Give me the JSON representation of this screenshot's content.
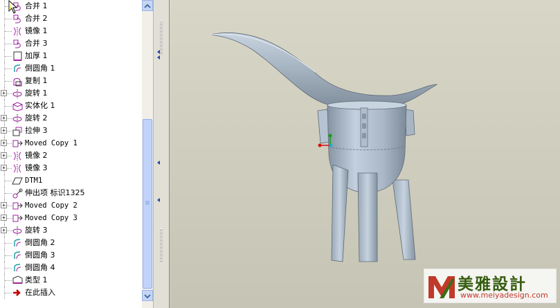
{
  "model_tree": {
    "items": [
      {
        "label": "合并 1",
        "icon": "merge-icon",
        "expandable": false
      },
      {
        "label": "合并 2",
        "icon": "merge-icon",
        "expandable": false
      },
      {
        "label": "镜像 1",
        "icon": "mirror-icon",
        "expandable": false
      },
      {
        "label": "合并 3",
        "icon": "merge-icon",
        "expandable": false
      },
      {
        "label": "加厚 1",
        "icon": "thicken-icon",
        "expandable": false
      },
      {
        "label": "倒圆角 1",
        "icon": "round-icon",
        "expandable": false
      },
      {
        "label": "复制 1",
        "icon": "copy-icon",
        "expandable": false
      },
      {
        "label": "旋转 1",
        "icon": "revolve-icon",
        "expandable": true
      },
      {
        "label": "实体化 1",
        "icon": "solidify-icon",
        "expandable": false
      },
      {
        "label": "旋转 2",
        "icon": "revolve-icon",
        "expandable": true
      },
      {
        "label": "拉伸 3",
        "icon": "extrude-icon",
        "expandable": true
      },
      {
        "label": "Moved Copy 1",
        "icon": "moved-copy-icon",
        "expandable": true
      },
      {
        "label": "镜像 2",
        "icon": "mirror-icon",
        "expandable": true
      },
      {
        "label": "镜像 3",
        "icon": "mirror-icon",
        "expandable": true
      },
      {
        "label": "DTM1",
        "icon": "datum-plane-icon",
        "expandable": false
      },
      {
        "label": "伸出项 标识1325",
        "icon": "protrusion-icon",
        "expandable": false
      },
      {
        "label": "Moved Copy 2",
        "icon": "moved-copy-icon",
        "expandable": true
      },
      {
        "label": "Moved Copy 3",
        "icon": "moved-copy-icon",
        "expandable": true
      },
      {
        "label": "旋转 3",
        "icon": "revolve-icon",
        "expandable": true
      },
      {
        "label": "倒圆角 2",
        "icon": "round-icon",
        "expandable": false
      },
      {
        "label": "倒圆角 3",
        "icon": "round-icon",
        "expandable": false
      },
      {
        "label": "倒圆角 4",
        "icon": "round-icon",
        "expandable": false
      },
      {
        "label": "类型 1",
        "icon": "type-icon",
        "expandable": false
      },
      {
        "label": "在此插入",
        "icon": "insert-here-arrow-icon",
        "expandable": false
      }
    ]
  },
  "colors": {
    "model_fill": "#aab8c8",
    "model_shade": "#7f8d9c",
    "feature_icon": "#a020a0",
    "insert_arrow": "#c00000"
  },
  "watermark": {
    "logo_text": "M",
    "title": "美雅設計",
    "url": "www.meiyadesign.com"
  }
}
